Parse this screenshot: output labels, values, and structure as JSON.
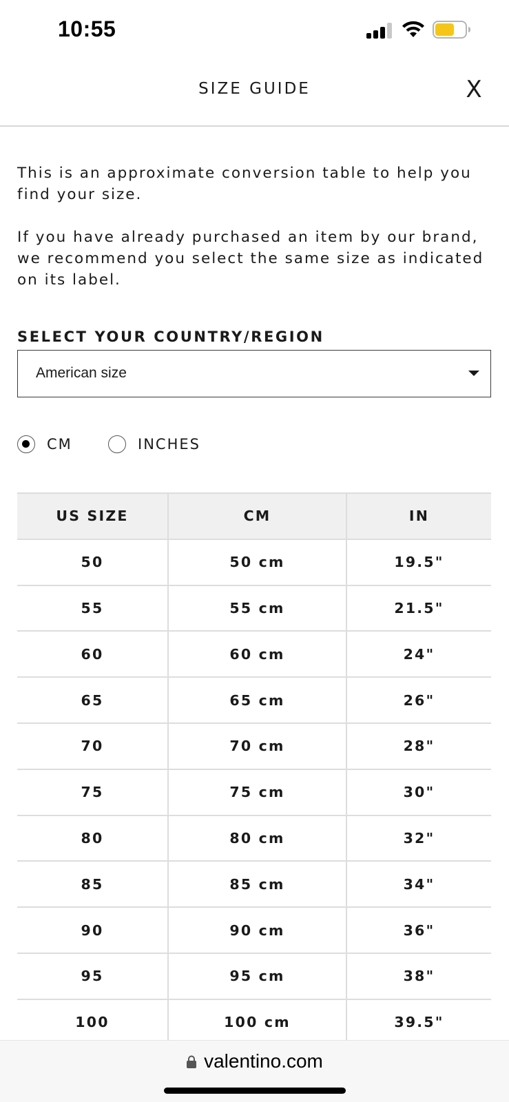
{
  "status_bar": {
    "time": "10:55",
    "battery_color": "#f5c518"
  },
  "header": {
    "title": "SIZE GUIDE",
    "close_label": "X"
  },
  "intro": {
    "paragraph1": "This is an approximate conversion table to help you find your size.",
    "paragraph2": "If you have already purchased an item by our brand, we recommend you select the same size as indicated on its label."
  },
  "country_select": {
    "label": "SELECT YOUR COUNTRY/REGION",
    "selected_value": "American size"
  },
  "units": {
    "options": [
      {
        "label": "CM",
        "checked": true
      },
      {
        "label": "INCHES",
        "checked": false
      }
    ]
  },
  "size_table": {
    "headers": [
      "US SIZE",
      "CM",
      "IN"
    ],
    "rows": [
      [
        "50",
        "50 cm",
        "19.5\""
      ],
      [
        "55",
        "55 cm",
        "21.5\""
      ],
      [
        "60",
        "60 cm",
        "24\""
      ],
      [
        "65",
        "65 cm",
        "26\""
      ],
      [
        "70",
        "70 cm",
        "28\""
      ],
      [
        "75",
        "75 cm",
        "30\""
      ],
      [
        "80",
        "80 cm",
        "32\""
      ],
      [
        "85",
        "85 cm",
        "34\""
      ],
      [
        "90",
        "90 cm",
        "36\""
      ],
      [
        "95",
        "95 cm",
        "38\""
      ],
      [
        "100",
        "100 cm",
        "39.5\""
      ]
    ]
  },
  "browser": {
    "url": "valentino.com"
  }
}
